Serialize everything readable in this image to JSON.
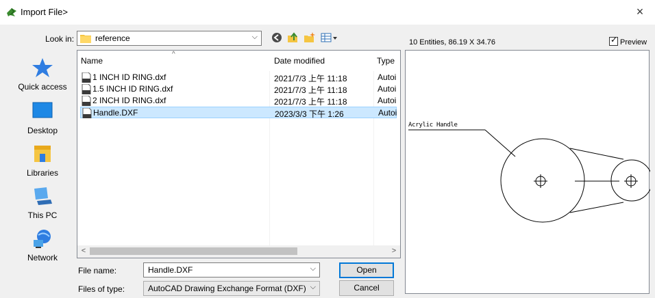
{
  "window": {
    "title": "Import File>",
    "close_glyph": "×"
  },
  "look_in": {
    "label": "Look in:",
    "value": "reference",
    "arrow_glyph": "⌵"
  },
  "toolbar": {
    "icons": [
      "back-icon",
      "up-folder-icon",
      "new-folder-icon",
      "view-menu-icon"
    ]
  },
  "places": [
    {
      "label": "Quick access",
      "icon": "quick-access-icon"
    },
    {
      "label": "Desktop",
      "icon": "desktop-icon"
    },
    {
      "label": "Libraries",
      "icon": "libraries-icon"
    },
    {
      "label": "This PC",
      "icon": "this-pc-icon"
    },
    {
      "label": "Network",
      "icon": "network-icon"
    }
  ],
  "file_list": {
    "columns": [
      "Name",
      "Date modified",
      "Type"
    ],
    "sort_glyph": "^",
    "rows": [
      {
        "name": "1 INCH ID RING.dxf",
        "date": "2021/7/3 上午 11:18",
        "type": "Autoi"
      },
      {
        "name": "1.5 INCH ID RING.dxf",
        "date": "2021/7/3 上午 11:18",
        "type": "Autoi"
      },
      {
        "name": "2 INCH ID RING.dxf",
        "date": "2021/7/3 上午 11:18",
        "type": "Autoi"
      },
      {
        "name": "Handle.DXF",
        "date": "2023/3/3 下午 1:26",
        "type": "Autoi"
      }
    ],
    "selected_index": 3,
    "scroll_left_glyph": "<",
    "scroll_right_glyph": ">"
  },
  "file_name": {
    "label": "File name:",
    "value": "Handle.DXF",
    "arrow_glyph": "⌵"
  },
  "file_type": {
    "label": "Files of type:",
    "value": "AutoCAD Drawing Exchange Format (DXF)",
    "arrow_glyph": "⌵"
  },
  "buttons": {
    "open": "Open",
    "cancel": "Cancel"
  },
  "preview": {
    "info": "10 Entities, 86.19 X 34.76",
    "checkbox_label": "Preview",
    "checked": true,
    "check_glyph": "✓",
    "drawing_label": "Acrylic Handle"
  },
  "colors": {
    "selection_bg": "#cce8ff",
    "selection_border": "#99d1ff",
    "default_button_border": "#0078d7",
    "folder_yellow": "#f5c542",
    "app_icon_green": "#3a8a2e"
  }
}
